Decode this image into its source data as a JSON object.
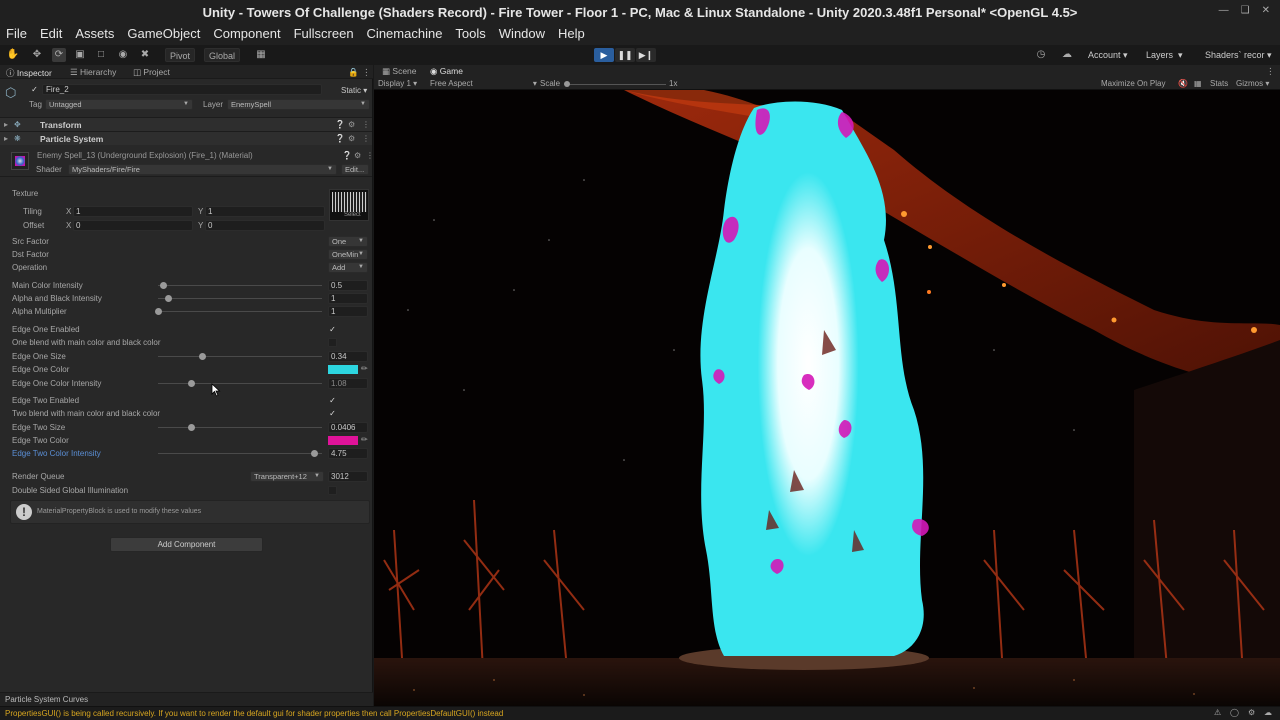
{
  "window": {
    "title": "Unity - Towers Of Challenge (Shaders Record) - Fire Tower - Floor 1 - PC, Mac & Linux Standalone - Unity 2020.3.48f1 Personal* <OpenGL 4.5>"
  },
  "menu": [
    "File",
    "Edit",
    "Assets",
    "GameObject",
    "Component",
    "Fullscreen",
    "Cinemachine",
    "Tools",
    "Window",
    "Help"
  ],
  "toolbar": {
    "pivot": "Pivot",
    "global": "Global",
    "account": "Account",
    "layers": "Layers",
    "layout": "Shaders` recor"
  },
  "left_tabs": [
    "Inspector",
    "Hierarchy",
    "Project"
  ],
  "inspector": {
    "object_name": "Fire_2",
    "static_label": "Static",
    "tag_label": "Tag",
    "tag_value": "Untagged",
    "layer_label": "Layer",
    "layer_value": "EnemySpell",
    "components": [
      "Transform",
      "Particle System"
    ],
    "material_name": "Enemy Spell_13 (Underground Explosion) (Fire_1) (Material)",
    "shader_label": "Shader",
    "shader_value": "MyShaders/Fire/Fire",
    "edit_button": "Edit...",
    "texture_label": "Texture",
    "tiling_label": "Tiling",
    "offset_label": "Offset",
    "tiling_x": "1",
    "tiling_y": "1",
    "offset_x": "0",
    "offset_y": "0",
    "x_label": "X",
    "y_label": "Y",
    "select_label": "Select",
    "src_factor_label": "Src Factor",
    "src_factor_value": "One",
    "dst_factor_label": "Dst Factor",
    "dst_factor_value": "OneMin",
    "operation_label": "Operation",
    "operation_value": "Add",
    "main_color_intensity_label": "Main Color Intensity",
    "main_color_intensity_value": "0.5",
    "main_color_intensity_level": 0.03,
    "alpha_black_label": "Alpha and Black Intensity",
    "alpha_black_value": "1",
    "alpha_black_level": 0.06,
    "alpha_mult_label": "Alpha Multiplier",
    "alpha_mult_value": "1",
    "alpha_mult_level": 0.0,
    "edge_one_enabled_label": "Edge One Enabled",
    "one_blend_label": "One blend with main color and black color",
    "edge_one_size_label": "Edge One Size",
    "edge_one_size_value": "0.34",
    "edge_one_size_level": 0.27,
    "edge_one_color_label": "Edge One Color",
    "edge_one_color": "#2dd6e0",
    "edge_one_intensity_label": "Edge One Color Intensity",
    "edge_one_intensity_value": "1.08",
    "edge_one_intensity_level": 0.2,
    "edge_two_enabled_label": "Edge Two Enabled",
    "two_blend_label": "Two blend with main color and black color",
    "edge_two_size_label": "Edge Two Size",
    "edge_two_size_value": "0.0406",
    "edge_two_size_level": 0.2,
    "edge_two_color_label": "Edge Two Color",
    "edge_two_color": "#e0139a",
    "edge_two_intensity_label": "Edge Two Color Intensity",
    "edge_two_intensity_value": "4.75",
    "edge_two_intensity_level": 0.95,
    "render_queue_label": "Render Queue",
    "render_queue_mode": "Transparent+12",
    "render_queue_value": "3012",
    "double_sided_label": "Double Sided Global Illumination",
    "info_message": "MaterialPropertyBlock is used to modify these values",
    "add_component": "Add Component",
    "curves_label": "Particle System Curves"
  },
  "game_view": {
    "tabs": [
      "Scene",
      "Game"
    ],
    "display": "Display 1",
    "aspect": "Free Aspect",
    "scale_label": "Scale",
    "scale_value": "1x",
    "maximize": "Maximize On Play",
    "stats": "Stats",
    "gizmos": "Gizmos"
  },
  "status": {
    "message": "PropertiesGUI() is being called recursively. If you want to render the default gui for shader properties then call PropertiesDefaultGUI() instead"
  },
  "colors": {
    "accent": "#2a5e9e",
    "warning": "#d8a620",
    "link": "#5b8fd6"
  }
}
